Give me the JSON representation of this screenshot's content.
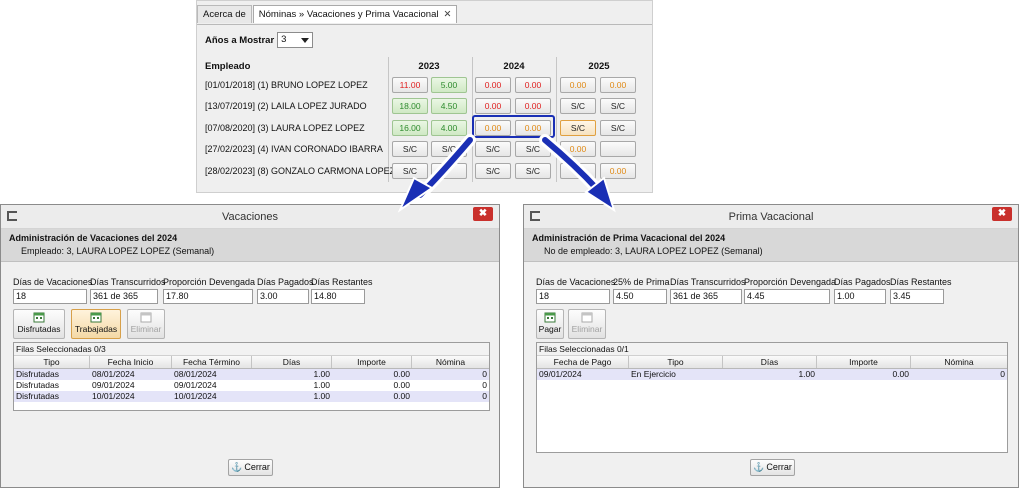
{
  "top": {
    "tabs": [
      {
        "label": "Acerca de"
      },
      {
        "label": "Nóminas » Vacaciones y Prima Vacacional",
        "close": "✕"
      }
    ],
    "years_label": "Años a Mostrar",
    "years_value": "3",
    "employee_header": "Empleado",
    "year_headers": [
      "2023",
      "2024",
      "2025"
    ],
    "employees": [
      {
        "name": "[01/01/2018] (1) BRUNO LOPEZ LOPEZ",
        "cells": [
          "11.00",
          "5.00",
          "0.00",
          "0.00",
          "0.00",
          "0.00"
        ]
      },
      {
        "name": "[13/07/2019] (2) LAILA LOPEZ JURADO",
        "cells": [
          "18.00",
          "4.50",
          "0.00",
          "0.00",
          "S/C",
          "S/C"
        ]
      },
      {
        "name": "[07/08/2020] (3) LAURA LOPEZ LOPEZ",
        "cells": [
          "16.00",
          "4.00",
          "0.00",
          "0.00",
          "S/C",
          "S/C"
        ]
      },
      {
        "name": "[27/02/2023] (4) IVAN CORONADO IBARRA",
        "cells": [
          "S/C",
          "S/C",
          "S/C",
          "S/C",
          "0.00",
          ""
        ]
      },
      {
        "name": "[28/02/2023] (8) GONZALO CARMONA LOPEZ",
        "cells": [
          "S/C",
          "",
          "S/C",
          "S/C",
          "",
          "0.00"
        ]
      }
    ],
    "colors": {
      "red": "#e02020",
      "green": "#2e8b2e",
      "orange": "#e08a16",
      "highlight": "#1a2fb5"
    }
  },
  "vacaciones": {
    "title": "Vacaciones",
    "close": "✖",
    "header_title": "Administración de Vacaciones del 2024",
    "header_sub": "Empleado: 3, LAURA LOPEZ LOPEZ (Semanal)",
    "fields": [
      {
        "label": "Días de Vacaciones",
        "value": "18"
      },
      {
        "label": "Días Transcurridos",
        "value": "361 de 365"
      },
      {
        "label": "Proporción Devengada",
        "value": "17.80"
      },
      {
        "label": "Días Pagados",
        "value": "3.00"
      },
      {
        "label": "Días Restantes",
        "value": "14.80"
      }
    ],
    "buttons": {
      "disfrutadas": "Disfrutadas",
      "trabajadas": "Trabajadas",
      "eliminar": "Eliminar"
    },
    "selected_rows": "Filas Seleccionadas 0/3",
    "columns": [
      "Tipo",
      "Fecha Inicio",
      "Fecha Término",
      "Días",
      "Importe",
      "Nómina"
    ],
    "rows": [
      [
        "Disfrutadas",
        "08/01/2024",
        "08/01/2024",
        "1.00",
        "0.00",
        "0"
      ],
      [
        "Disfrutadas",
        "09/01/2024",
        "09/01/2024",
        "1.00",
        "0.00",
        "0"
      ],
      [
        "Disfrutadas",
        "10/01/2024",
        "10/01/2024",
        "1.00",
        "0.00",
        "0"
      ]
    ],
    "cerrar": "Cerrar"
  },
  "prima": {
    "title": "Prima Vacacional",
    "close": "✖",
    "header_title": "Administración de Prima Vacacional del 2024",
    "header_sub": "No de empleado: 3, LAURA LOPEZ LOPEZ (Semanal)",
    "fields": [
      {
        "label": "Días de Vacaciones",
        "value": "18"
      },
      {
        "label": "25% de Prima",
        "value": "4.50"
      },
      {
        "label": "Días Transcurridos",
        "value": "361 de 365"
      },
      {
        "label": "Proporción Devengada",
        "value": "4.45"
      },
      {
        "label": "Días Pagados",
        "value": "1.00"
      },
      {
        "label": "Días Restantes",
        "value": "3.45"
      }
    ],
    "buttons": {
      "pagar": "Pagar",
      "eliminar": "Eliminar"
    },
    "selected_rows": "Filas Seleccionadas 0/1",
    "columns": [
      "Fecha de Pago",
      "Tipo",
      "Días",
      "Importe",
      "Nómina"
    ],
    "rows": [
      [
        "09/01/2024",
        "En Ejercicio",
        "1.00",
        "0.00",
        "0"
      ]
    ],
    "cerrar": "Cerrar"
  }
}
